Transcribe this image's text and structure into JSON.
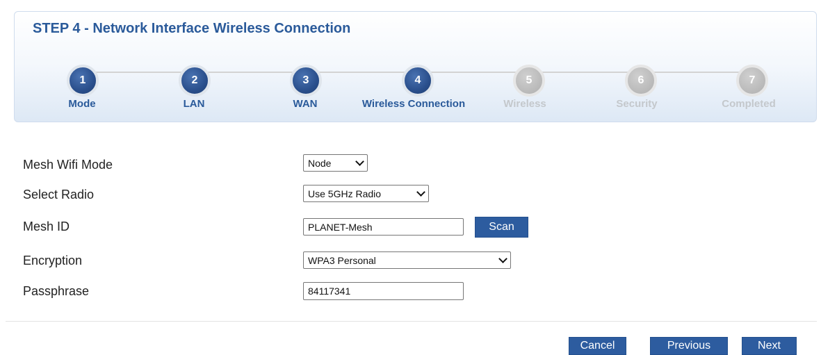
{
  "wizard": {
    "title": "STEP 4 - Network Interface Wireless Connection",
    "steps": [
      {
        "num": "1",
        "label": "Mode",
        "state": "done"
      },
      {
        "num": "2",
        "label": "LAN",
        "state": "done"
      },
      {
        "num": "3",
        "label": "WAN",
        "state": "done"
      },
      {
        "num": "4",
        "label": "Wireless Connection",
        "state": "done"
      },
      {
        "num": "5",
        "label": "Wireless",
        "state": "todo"
      },
      {
        "num": "6",
        "label": "Security",
        "state": "todo"
      },
      {
        "num": "7",
        "label": "Completed",
        "state": "todo"
      }
    ]
  },
  "form": {
    "mesh_mode": {
      "label": "Mesh Wifi Mode",
      "value": "Node"
    },
    "radio": {
      "label": "Select Radio",
      "value": "Use 5GHz Radio"
    },
    "mesh_id": {
      "label": "Mesh ID",
      "value": "PLANET-Mesh",
      "scan_label": "Scan"
    },
    "encryption": {
      "label": "Encryption",
      "value": "WPA3 Personal"
    },
    "passphrase": {
      "label": "Passphrase",
      "value": "84117341"
    }
  },
  "footer": {
    "cancel_label": "Cancel",
    "previous_label": "Previous",
    "next_label": "Next"
  }
}
